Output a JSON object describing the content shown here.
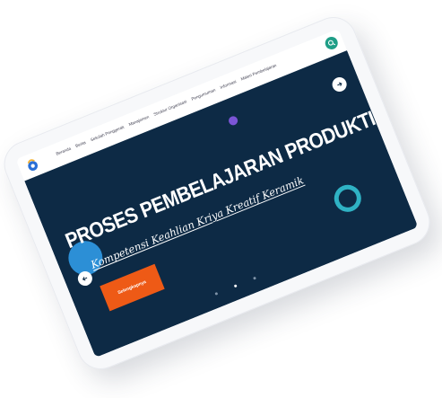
{
  "nav": {
    "items": [
      {
        "label": "Beranda"
      },
      {
        "label": "Berita"
      },
      {
        "label": "Sekolah Penggerak"
      },
      {
        "label": "Manajemen"
      },
      {
        "label": "Struktur Organisasi"
      },
      {
        "label": "Pengumuman"
      },
      {
        "label": "Informasi"
      },
      {
        "label": "Materi Pembelajaran"
      }
    ]
  },
  "hero": {
    "title": "PROSES PEMBELAJARAN PRODUKTIF",
    "subtitle": "Kompetensi Keahlian Kriya Kreatif Keramik",
    "cta_label": "Selengkapnya"
  },
  "carousel": {
    "slide_count": 3,
    "active_index": 1
  },
  "colors": {
    "hero_background": "#0d2a45",
    "cta": "#ee5a16",
    "search_button": "#1f9e87",
    "blob_blue": "#2c8fd6",
    "blob_purple": "#7b55d6",
    "ring": "#2fb2c4"
  },
  "icons": {
    "logo": "school-logo-icon",
    "search": "search-icon",
    "prev": "arrow-left-icon",
    "next": "arrow-right-icon"
  }
}
